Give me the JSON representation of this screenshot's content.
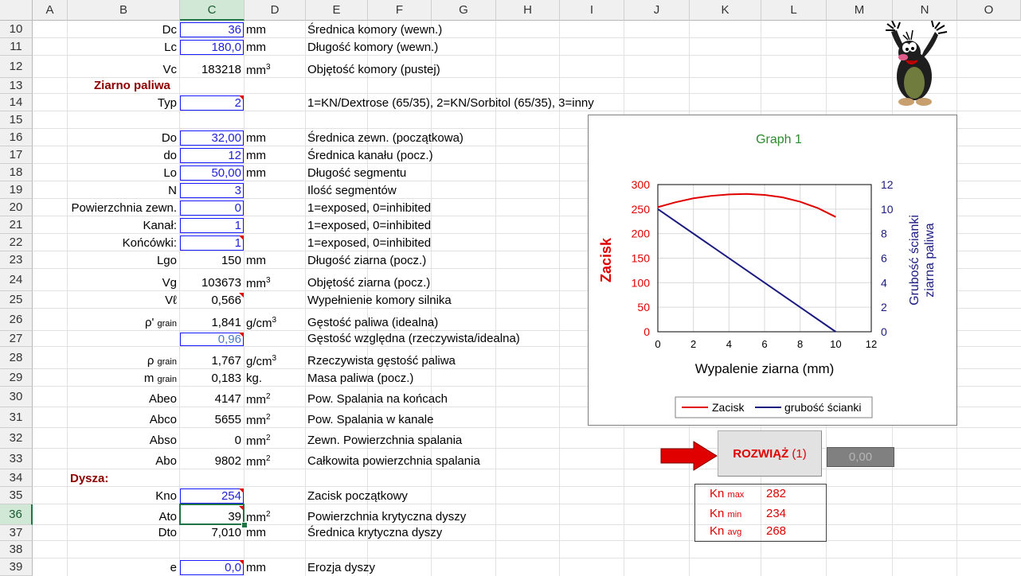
{
  "columns": [
    "A",
    "B",
    "C",
    "D",
    "E",
    "F",
    "G",
    "H",
    "I",
    "J",
    "K",
    "L",
    "M",
    "N",
    "O"
  ],
  "rows": [
    "10",
    "11",
    "12",
    "13",
    "14",
    "15",
    "16",
    "17",
    "18",
    "19",
    "20",
    "21",
    "22",
    "23",
    "24",
    "25",
    "26",
    "27",
    "28",
    "29",
    "30",
    "31",
    "32",
    "33",
    "34",
    "35",
    "36",
    "37",
    "38",
    "39"
  ],
  "active_col": "C",
  "active_row": "36",
  "cells": {
    "r10": {
      "label": "Dc",
      "value": "36",
      "unit": "mm",
      "desc": "Średnica komory (wewn.)"
    },
    "r11": {
      "label": "Lc",
      "value": "180,0",
      "unit": "mm",
      "desc": "Długość komory (wewn.)"
    },
    "r12": {
      "label": "Vc",
      "value": "183218",
      "unit": "mm",
      "sup": "3",
      "desc": "Objętość komory (pustej)"
    },
    "r13": {
      "section": "Ziarno paliwa"
    },
    "r14": {
      "label": "Typ",
      "value": "2",
      "desc": "1=KN/Dextrose (65/35), 2=KN/Sorbitol (65/35), 3=inny"
    },
    "r16": {
      "label": "Do",
      "value": "32,00",
      "unit": "mm",
      "desc": "Średnica zewn. (początkowa)"
    },
    "r17": {
      "label": "do",
      "value": "12",
      "unit": "mm",
      "desc": "Średnica kanału (pocz.)"
    },
    "r18": {
      "label": "Lo",
      "value": "50,00",
      "unit": "mm",
      "desc": "Długość segmentu"
    },
    "r19": {
      "label": "N",
      "value": "3",
      "desc": "Ilość segmentów"
    },
    "r20": {
      "label": "Powierzchnia zewn.",
      "value": "0",
      "desc": "1=exposed, 0=inhibited"
    },
    "r21": {
      "label": "Kanał:",
      "value": "1",
      "desc": "1=exposed, 0=inhibited"
    },
    "r22": {
      "label": "Końcówki:",
      "value": "1",
      "desc": "1=exposed, 0=inhibited"
    },
    "r23": {
      "label": "Lgo",
      "value": "150",
      "unit": "mm",
      "desc": "Długość ziarna (pocz.)"
    },
    "r24": {
      "label": "Vg",
      "value": "103673",
      "unit": "mm",
      "sup": "3",
      "desc": "Objętość ziarna (pocz.)"
    },
    "r25": {
      "label": "Vℓ",
      "value": "0,566",
      "desc": "Wypełnienie komory silnika"
    },
    "r26": {
      "label": "ρ'",
      "label_sub": "grain",
      "value": "1,841",
      "unit": "g/cm",
      "sup": "3",
      "desc": "Gęstość paliwa (idealna)"
    },
    "r27": {
      "value": "0,96",
      "desc": "Gęstość względna (rzeczywista/idealna)"
    },
    "r28": {
      "label": "ρ",
      "label_sub": "grain",
      "value": "1,767",
      "unit": "g/cm",
      "sup": "3",
      "desc": "Rzeczywista gęstość paliwa"
    },
    "r29": {
      "label": "m",
      "label_sub": "grain",
      "value": "0,183",
      "unit": "kg.",
      "desc": "Masa paliwa (pocz.)"
    },
    "r30": {
      "label": "Abeo",
      "value": "4147",
      "unit": "mm",
      "sup": "2",
      "desc": "Pow. Spalania na końcach"
    },
    "r31": {
      "label": "Abco",
      "value": "5655",
      "unit": "mm",
      "sup": "2",
      "desc": "Pow. Spalania w kanale"
    },
    "r32": {
      "label": "Abso",
      "value": "0",
      "unit": "mm",
      "sup": "2",
      "desc": "Zewn. Powierzchnia spalania"
    },
    "r33": {
      "label": "Abo",
      "value": "9802",
      "unit": "mm",
      "sup": "2",
      "desc": "Całkowita powierzchnia spalania"
    },
    "r34": {
      "section": "Dysza:"
    },
    "r35": {
      "label": "Kno",
      "value": "254",
      "desc": "Zacisk początkowy"
    },
    "r36": {
      "label": "Ato",
      "value": "39",
      "unit": "mm",
      "sup": "2",
      "desc": "Powierzchnia krytyczna dyszy"
    },
    "r37": {
      "label": "Dto",
      "value": "7,010",
      "unit": "mm",
      "desc": "Średnica krytyczna dyszy"
    },
    "r39": {
      "label": "e",
      "value": "0,0",
      "unit": "mm",
      "desc": "Erozja dyszy"
    }
  },
  "solve_button": {
    "label": "ROZWIĄŻ",
    "suffix": "(1)"
  },
  "output_value": "0,00",
  "kn_stats": [
    {
      "key": "Kn",
      "sub": "max",
      "value": "282"
    },
    {
      "key": "Kn",
      "sub": "min",
      "value": "234"
    },
    {
      "key": "Kn",
      "sub": "avg",
      "value": "268"
    }
  ],
  "colors": {
    "input_text": "#2121d8",
    "section": "#8b0000",
    "accent": "#217346",
    "zacisk": "#e00000",
    "wall": "#1a1a80"
  },
  "chart_data": {
    "type": "line",
    "title": "Graph 1",
    "xlabel": "Wypalenie ziarna  (mm)",
    "ylabel": "Zacisk",
    "ylabel2": "Grubość ścianki ziarna paliwa",
    "xlim": [
      0,
      12
    ],
    "ylim": [
      0,
      300
    ],
    "y2lim": [
      0,
      12
    ],
    "xticks": [
      "0",
      "2",
      "4",
      "6",
      "8",
      "10",
      "12"
    ],
    "yticks": [
      "0",
      "50",
      "100",
      "150",
      "200",
      "250",
      "300"
    ],
    "y2ticks": [
      "0",
      "2",
      "4",
      "6",
      "8",
      "10",
      "12"
    ],
    "grid": true,
    "legend": "bottom",
    "series": [
      {
        "name": "Zacisk",
        "axis": "y",
        "color": "#e00000",
        "x": [
          0,
          1,
          2,
          3,
          4,
          5,
          6,
          7,
          8,
          9,
          10
        ],
        "y": [
          254,
          264,
          272,
          277,
          280,
          281,
          279,
          274,
          265,
          252,
          234
        ]
      },
      {
        "name": "grubość ścianki",
        "axis": "y2",
        "color": "#1a1a80",
        "x": [
          0,
          10
        ],
        "y": [
          10,
          0
        ]
      }
    ]
  }
}
